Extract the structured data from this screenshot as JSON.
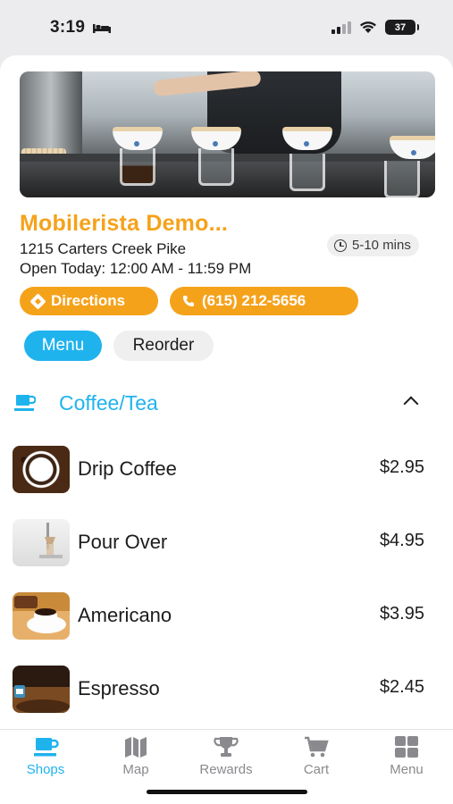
{
  "status_bar": {
    "time": "3:19",
    "battery": "37"
  },
  "shop": {
    "name": "Mobilerista Demo...",
    "address": "1215 Carters Creek Pike",
    "hours": "Open Today: 12:00 AM - 11:59 PM",
    "wait_time": "5-10 mins",
    "directions_label": "Directions",
    "phone_label": "(615) 212-5656"
  },
  "tabs": [
    {
      "label": "Menu",
      "active": true
    },
    {
      "label": "Reorder",
      "active": false
    }
  ],
  "category": {
    "title": "Coffee/Tea",
    "expanded": true
  },
  "menu_items": [
    {
      "name": "Drip Coffee",
      "price": "$2.95"
    },
    {
      "name": "Pour Over",
      "price": "$4.95"
    },
    {
      "name": "Americano",
      "price": "$3.95"
    },
    {
      "name": "Espresso",
      "price": "$2.45"
    }
  ],
  "bottom_nav": [
    {
      "label": "Shops",
      "icon": "cup-icon",
      "active": true
    },
    {
      "label": "Map",
      "icon": "map-icon",
      "active": false
    },
    {
      "label": "Rewards",
      "icon": "trophy-icon",
      "active": false
    },
    {
      "label": "Cart",
      "icon": "cart-icon",
      "active": false
    },
    {
      "label": "Menu",
      "icon": "grid-icon",
      "active": false
    }
  ],
  "colors": {
    "accent_orange": "#f5a21b",
    "accent_blue": "#1fb3ee"
  }
}
